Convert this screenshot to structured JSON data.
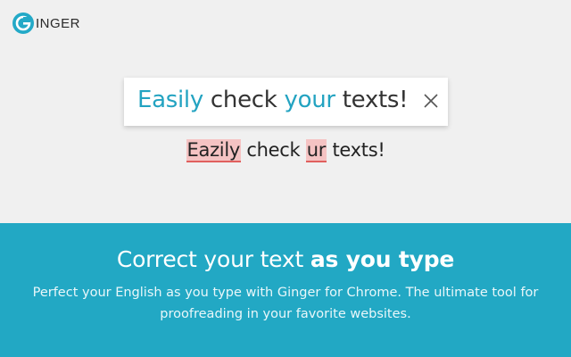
{
  "brand": {
    "logo_letter": "G",
    "logo_text": "INGER",
    "icon": "ginger-logo-icon",
    "accent_color": "#23a9c7"
  },
  "card": {
    "word1": "Easily",
    "word2": " check ",
    "word3": "your",
    "word4": " texts!",
    "close_icon": "close-icon"
  },
  "original": {
    "error1": "Eazily",
    "text1": " check ",
    "error2": "ur",
    "text2": " texts!"
  },
  "banner": {
    "headline_regular": "Correct your text ",
    "headline_bold": "as you type",
    "description": "Perfect your English as you type with Ginger for Chrome. The ultimate tool for proofreading in your favorite websites.",
    "background_color": "#22a8c4"
  }
}
